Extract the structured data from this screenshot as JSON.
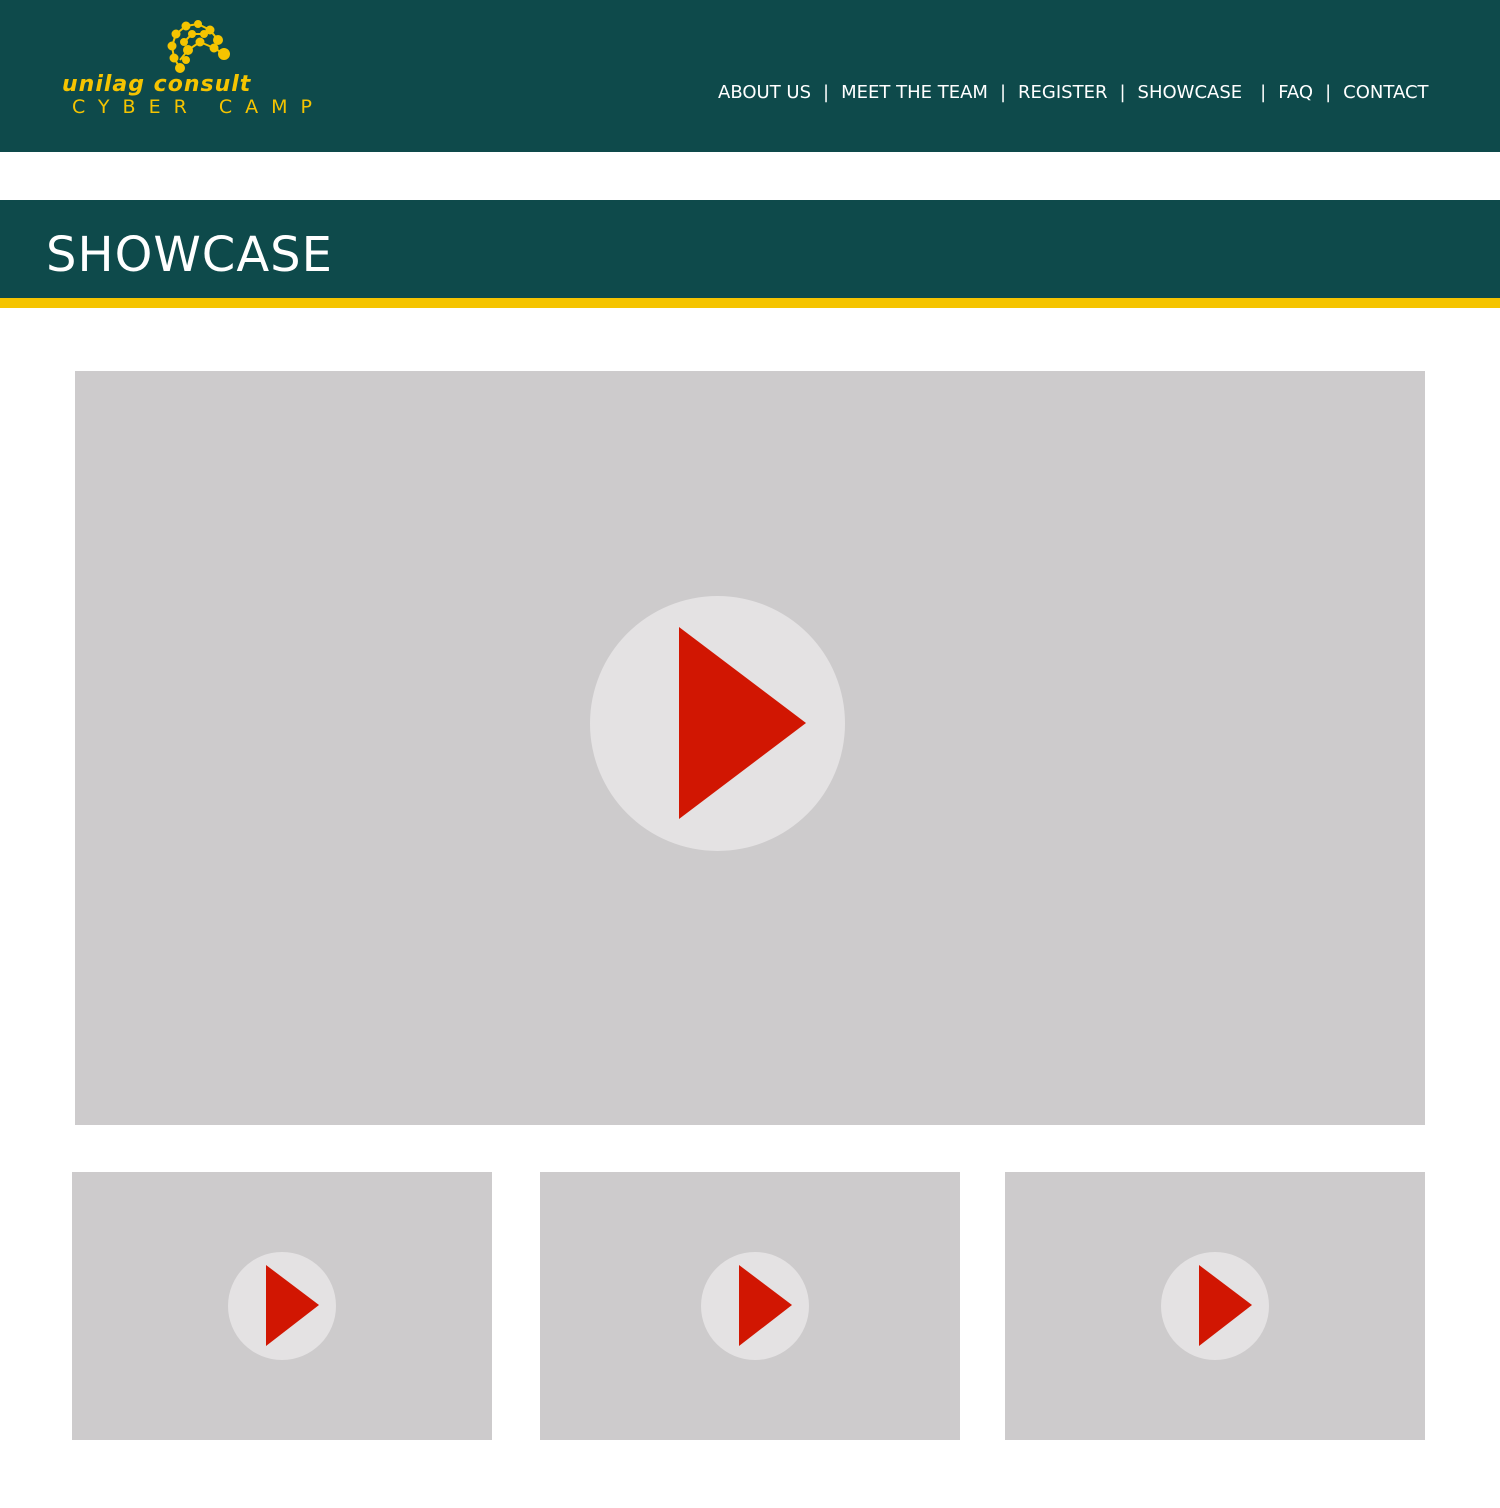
{
  "brand": {
    "name": "unilag consult",
    "tagline": "CYBER CAMP",
    "color_primary": "#0e4a4b",
    "color_accent": "#f5c400",
    "logo_icon": "molecule-swirl-icon"
  },
  "nav": {
    "items": [
      {
        "label": "ABOUT US"
      },
      {
        "label": "MEET THE TEAM"
      },
      {
        "label": "REGISTER"
      },
      {
        "label": "SHOWCASE"
      },
      {
        "label": "FAQ"
      },
      {
        "label": "CONTACT"
      }
    ],
    "separator": "|"
  },
  "page": {
    "title": "SHOWCASE"
  },
  "videos": {
    "play_icon": "play-icon",
    "play_color": "#d11602",
    "placeholder_color": "#cdcbcc",
    "featured": {
      "icon": "play-icon"
    },
    "thumbnails": [
      {
        "icon": "play-icon"
      },
      {
        "icon": "play-icon"
      },
      {
        "icon": "play-icon"
      }
    ]
  }
}
